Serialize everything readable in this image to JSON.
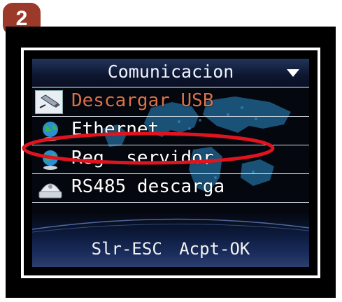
{
  "step_badge": "2",
  "screen": {
    "title": "Comunicacion",
    "menu_items": [
      {
        "label": "Descargar USB",
        "icon": "usb-drive-icon",
        "selected": true
      },
      {
        "label": "Ethernet",
        "icon": "globe-icon",
        "selected": false
      },
      {
        "label": "Reg. servidor",
        "icon": "globe-icon",
        "selected": false
      },
      {
        "label": "RS485 descarga",
        "icon": "rs485-device-icon",
        "selected": false
      }
    ],
    "softkeys": "Slr-ESC  Acpt-OK"
  },
  "colors": {
    "badge": "#9b3a2a",
    "selected_text": "#d8724a",
    "highlight_ellipse": "#e0141e"
  }
}
